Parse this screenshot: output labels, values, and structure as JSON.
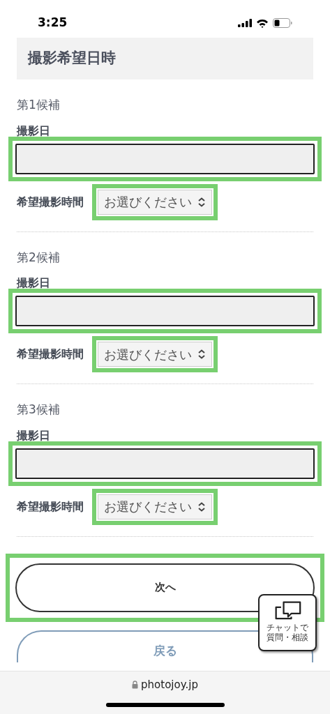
{
  "status_bar": {
    "time": "3:25"
  },
  "header": {
    "title": "撮影希望日時"
  },
  "candidates": [
    {
      "label": "第1候補",
      "date_label": "撮影日",
      "time_label": "希望撮影時間",
      "time_select": {
        "value": "お選びください"
      }
    },
    {
      "label": "第2候補",
      "date_label": "撮影日",
      "time_label": "希望撮影時間",
      "time_select": {
        "value": "お選びください"
      }
    },
    {
      "label": "第3候補",
      "date_label": "撮影日",
      "time_label": "希望撮影時間",
      "time_select": {
        "value": "お選びください"
      }
    }
  ],
  "next_button": "次へ",
  "back_button": "戻る",
  "chat_widget": {
    "line_1": "チャットで",
    "line_2": "質問・相談"
  },
  "browser_bar": {
    "url": "photojoy.jp"
  }
}
